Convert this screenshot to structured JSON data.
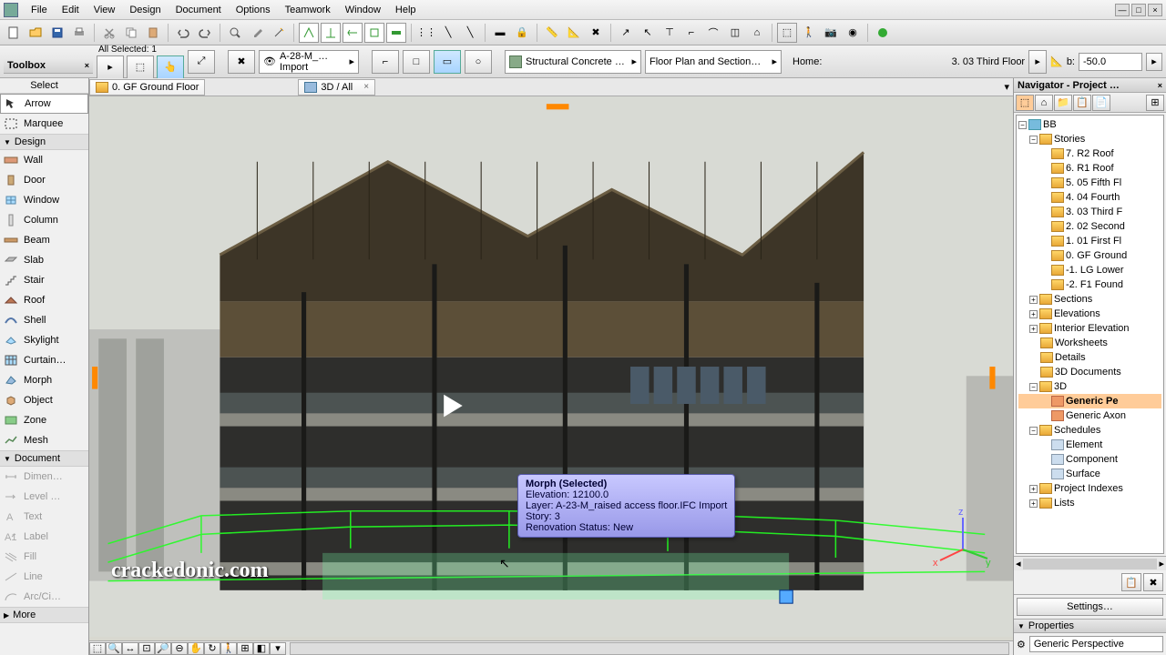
{
  "menu": [
    "File",
    "Edit",
    "View",
    "Design",
    "Document",
    "Options",
    "Teamwork",
    "Window",
    "Help"
  ],
  "toolbox": {
    "title": "Toolbox",
    "sub": "Select",
    "arrow": "Arrow",
    "marquee": "Marquee",
    "design_label": "Design",
    "design": [
      "Wall",
      "Door",
      "Window",
      "Column",
      "Beam",
      "Slab",
      "Stair",
      "Roof",
      "Shell",
      "Skylight",
      "Curtain…",
      "Morph",
      "Object",
      "Zone",
      "Mesh"
    ],
    "document_label": "Document",
    "document": [
      "Dimen…",
      "Level …",
      "Text",
      "Label",
      "Fill",
      "Line",
      "Arc/Ci…"
    ],
    "more": "More"
  },
  "info_bar": {
    "selected": "All Selected: 1",
    "layer": "A-28-M_…Import",
    "material": "Structural Concrete …",
    "floorplan": "Floor Plan and Section…",
    "home": "Home:",
    "story": "3. 03 Third Floor",
    "b_label": "b:",
    "b_value": "-50.0"
  },
  "tabs": [
    {
      "label": "0. GF Ground Floor",
      "icon": "folder"
    },
    {
      "label": "3D / All",
      "icon": "3d"
    }
  ],
  "navigator": {
    "title": "Navigator - Project …",
    "root": "BB",
    "stories_label": "Stories",
    "stories": [
      "7. R2 Roof",
      "6. R1 Roof",
      "5. 05 Fifth Fl",
      "4. 04 Fourth",
      "3. 03 Third F",
      "2. 02 Second",
      "1. 01 First Fl",
      "0. GF Ground",
      "-1. LG Lower",
      "-2. F1 Found"
    ],
    "groups": [
      "Sections",
      "Elevations",
      "Interior Elevation",
      "Worksheets",
      "Details",
      "3D Documents"
    ],
    "threed_label": "3D",
    "threed": [
      "Generic Pe",
      "Generic Axon"
    ],
    "schedules_label": "Schedules",
    "schedules": [
      "Element",
      "Component",
      "Surface"
    ],
    "project_indexes": "Project Indexes",
    "lists": "Lists",
    "settings": "Settings…"
  },
  "properties": {
    "label": "Properties",
    "value": "Generic Perspective"
  },
  "tooltip": {
    "title": "Morph (Selected)",
    "lines": [
      "Elevation: 12100.0",
      "Layer: A-23-M_raised access floor.IFC Import",
      "Story: 3",
      "Renovation Status: New"
    ]
  },
  "watermark": "crackedonic.com"
}
